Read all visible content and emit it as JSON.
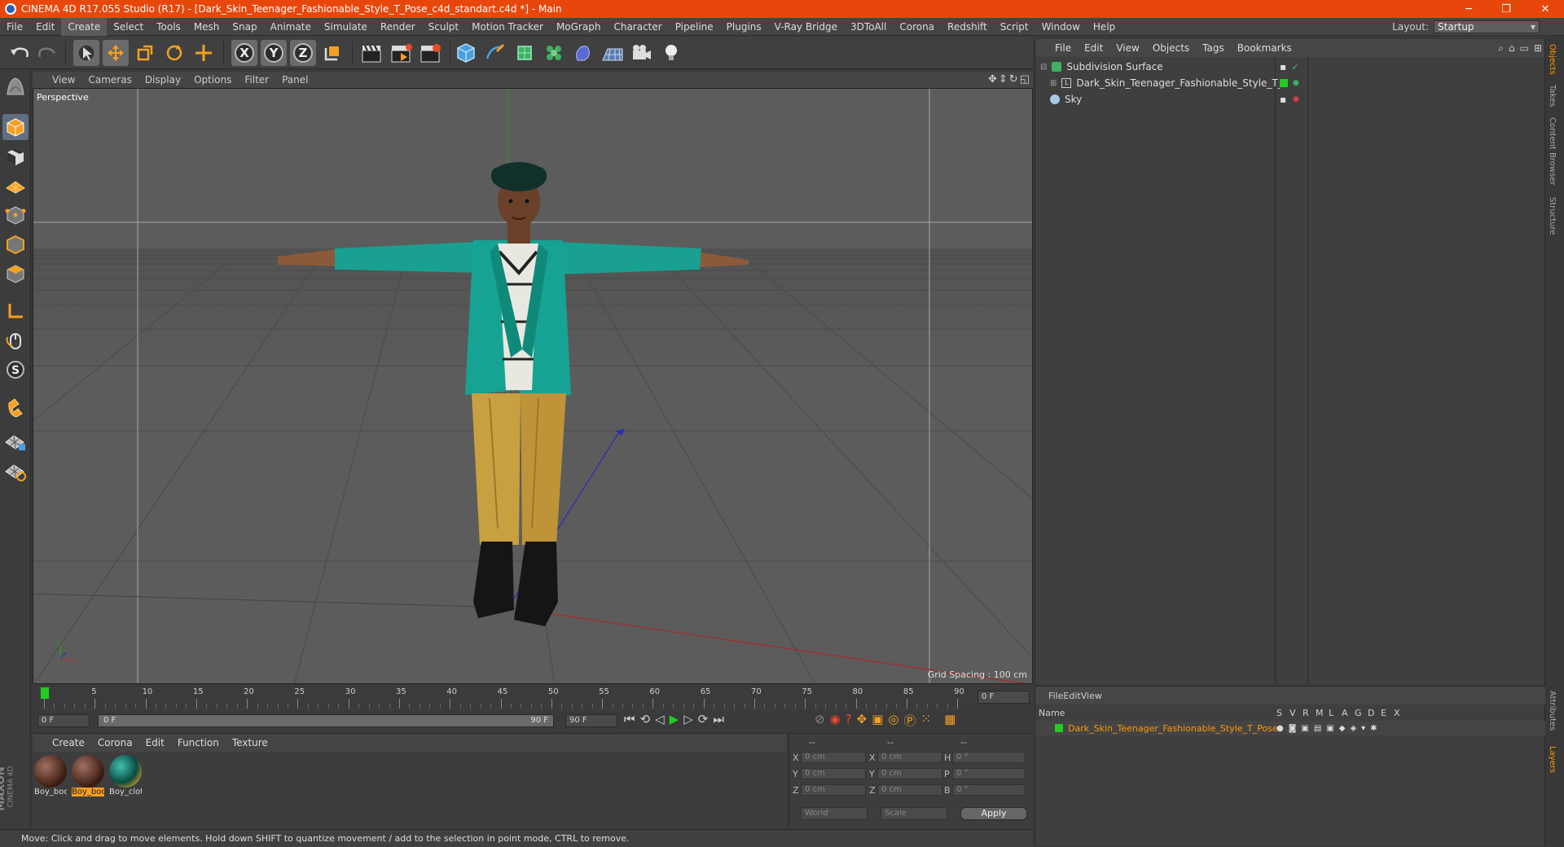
{
  "titlebar": {
    "title": "CINEMA 4D R17.055 Studio (R17) - [Dark_Skin_Teenager_Fashionable_Style_T_Pose_c4d_standart.c4d *] - Main",
    "minimize": "─",
    "restore": "❐",
    "close": "✕"
  },
  "menu": {
    "items": [
      "File",
      "Edit",
      "Create",
      "Select",
      "Tools",
      "Mesh",
      "Snap",
      "Animate",
      "Simulate",
      "Render",
      "Sculpt",
      "Motion Tracker",
      "MoGraph",
      "Character",
      "Pipeline",
      "Plugins",
      "V-Ray Bridge",
      "3DToAll",
      "Corona",
      "Redshift",
      "Script",
      "Window",
      "Help"
    ],
    "active": "Create",
    "layout_label": "Layout:",
    "layout_value": "Startup"
  },
  "viewport": {
    "menu": [
      "View",
      "Cameras",
      "Display",
      "Options",
      "Filter",
      "Panel"
    ],
    "label": "Perspective",
    "grid_spacing": "Grid Spacing : 100 cm"
  },
  "objects": {
    "menu": [
      "File",
      "Edit",
      "View",
      "Objects",
      "Tags",
      "Bookmarks"
    ],
    "rows": [
      {
        "name": "Subdivision Surface"
      },
      {
        "name": "Dark_Skin_Teenager_Fashionable_Style_T_Pose"
      },
      {
        "name": "Sky"
      }
    ]
  },
  "sidetabs": [
    "Objects",
    "Takes",
    "Content Browser",
    "Structure",
    "Attributes",
    "Layers"
  ],
  "timeline": {
    "ticks": [
      "0",
      "5",
      "10",
      "15",
      "20",
      "25",
      "30",
      "35",
      "40",
      "45",
      "50",
      "55",
      "60",
      "65",
      "70",
      "75",
      "80",
      "85",
      "90"
    ],
    "current_frame": "0 F",
    "start": "0 F",
    "range_start": "0 F",
    "range_end": "90 F",
    "end": "90 F"
  },
  "materials": {
    "menu": [
      "Create",
      "Corona",
      "Edit",
      "Function",
      "Texture"
    ],
    "items": [
      {
        "label": "Boy_boc"
      },
      {
        "label": "Boy_boc"
      },
      {
        "label": "Boy_clot"
      }
    ]
  },
  "coords": {
    "header": [
      "--",
      "--",
      "--"
    ],
    "rows": [
      {
        "a": "X",
        "av": "0 cm",
        "b": "X",
        "bv": "0 cm",
        "c": "H",
        "cv": "0 °"
      },
      {
        "a": "Y",
        "av": "0 cm",
        "b": "Y",
        "bv": "0 cm",
        "c": "P",
        "cv": "0 °"
      },
      {
        "a": "Z",
        "av": "0 cm",
        "b": "Z",
        "bv": "0 cm",
        "c": "B",
        "cv": "0 °"
      }
    ],
    "mode1": "World",
    "mode2": "Scale",
    "apply": "Apply"
  },
  "layers": {
    "menu": [
      "File",
      "Edit",
      "View"
    ],
    "col_name": "Name",
    "cols": [
      "S",
      "V",
      "R",
      "M",
      "L",
      "A",
      "G",
      "D",
      "E",
      "X"
    ],
    "row": "Dark_Skin_Teenager_Fashionable_Style_T_Pose"
  },
  "status": "Move: Click and drag to move elements. Hold down SHIFT to quantize movement / add to the selection in point mode, CTRL to remove.",
  "brand": {
    "line1": "MAXON",
    "line2": "CINEMA 4D"
  },
  "colors": {
    "titlebar": "#e8470c",
    "accent": "#ff9900",
    "layer_green": "#22cc22"
  }
}
